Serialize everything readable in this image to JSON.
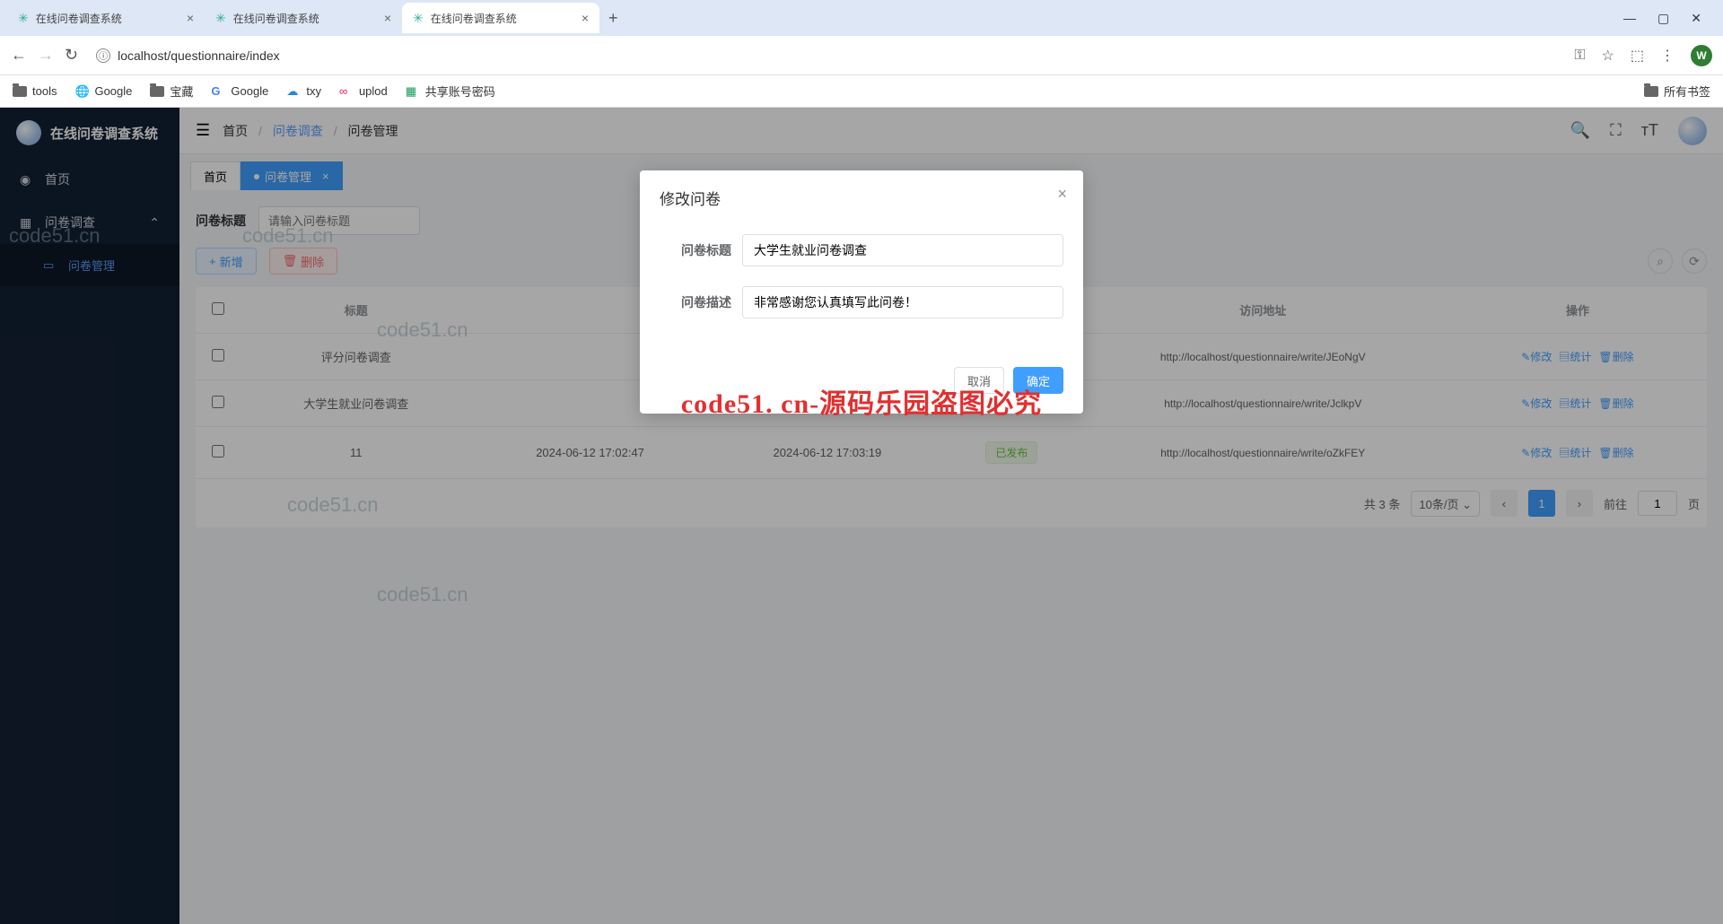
{
  "browser": {
    "tabs": [
      {
        "title": "在线问卷调查系统",
        "active": false
      },
      {
        "title": "在线问卷调查系统",
        "active": false
      },
      {
        "title": "在线问卷调查系统",
        "active": true
      }
    ],
    "url": "localhost/questionnaire/index",
    "bookmarks": [
      "tools",
      "Google",
      "宝藏",
      "Google",
      "txy",
      "uplod",
      "共享账号密码"
    ],
    "all_bookmarks": "所有书签",
    "avatar_letter": "W"
  },
  "sidebar": {
    "brand": "在线问卷调查系统",
    "menu": {
      "home": "首页",
      "survey": "问卷调查",
      "survey_manage": "问卷管理"
    }
  },
  "header": {
    "breadcrumb": {
      "home": "首页",
      "mid": "问卷调查",
      "leaf": "问卷管理"
    }
  },
  "page_tabs": {
    "home": "首页",
    "active": "问卷管理"
  },
  "filter": {
    "label": "问卷标题",
    "placeholder": "请输入问卷标题",
    "add": "新增",
    "delete": "删除"
  },
  "table": {
    "columns": [
      "标题",
      "",
      "",
      "",
      "访问地址",
      "操作"
    ],
    "header_url": "访问地址",
    "header_title": "标题",
    "header_action": "操作",
    "rows": [
      {
        "title": "评分问卷调查",
        "created": "",
        "updated": "",
        "status": "",
        "url": "http://localhost/questionnaire/write/JEoNgV"
      },
      {
        "title": "大学生就业问卷调查",
        "created": "",
        "updated": "",
        "status": "",
        "url": "http://localhost/questionnaire/write/JclkpV"
      },
      {
        "title": "11",
        "created": "2024-06-12 17:02:47",
        "updated": "2024-06-12 17:03:19",
        "status": "已发布",
        "url": "http://localhost/questionnaire/write/oZkFEY"
      }
    ],
    "actions": {
      "edit": "修改",
      "stats": "统计",
      "del": "删除"
    }
  },
  "pager": {
    "total": "共 3 条",
    "pagesize": "10条/页",
    "current": "1",
    "goto_label": "前往",
    "goto_value": "1",
    "page_unit": "页"
  },
  "modal": {
    "title": "修改问卷",
    "field_title_label": "问卷标题",
    "field_title_value": "大学生就业问卷调查",
    "field_desc_label": "问卷描述",
    "field_desc_value": "非常感谢您认真填写此问卷！",
    "cancel": "取消",
    "confirm": "确定"
  },
  "banner": "code51. cn-源码乐园盗图必究",
  "watermark_text": "code51.cn"
}
